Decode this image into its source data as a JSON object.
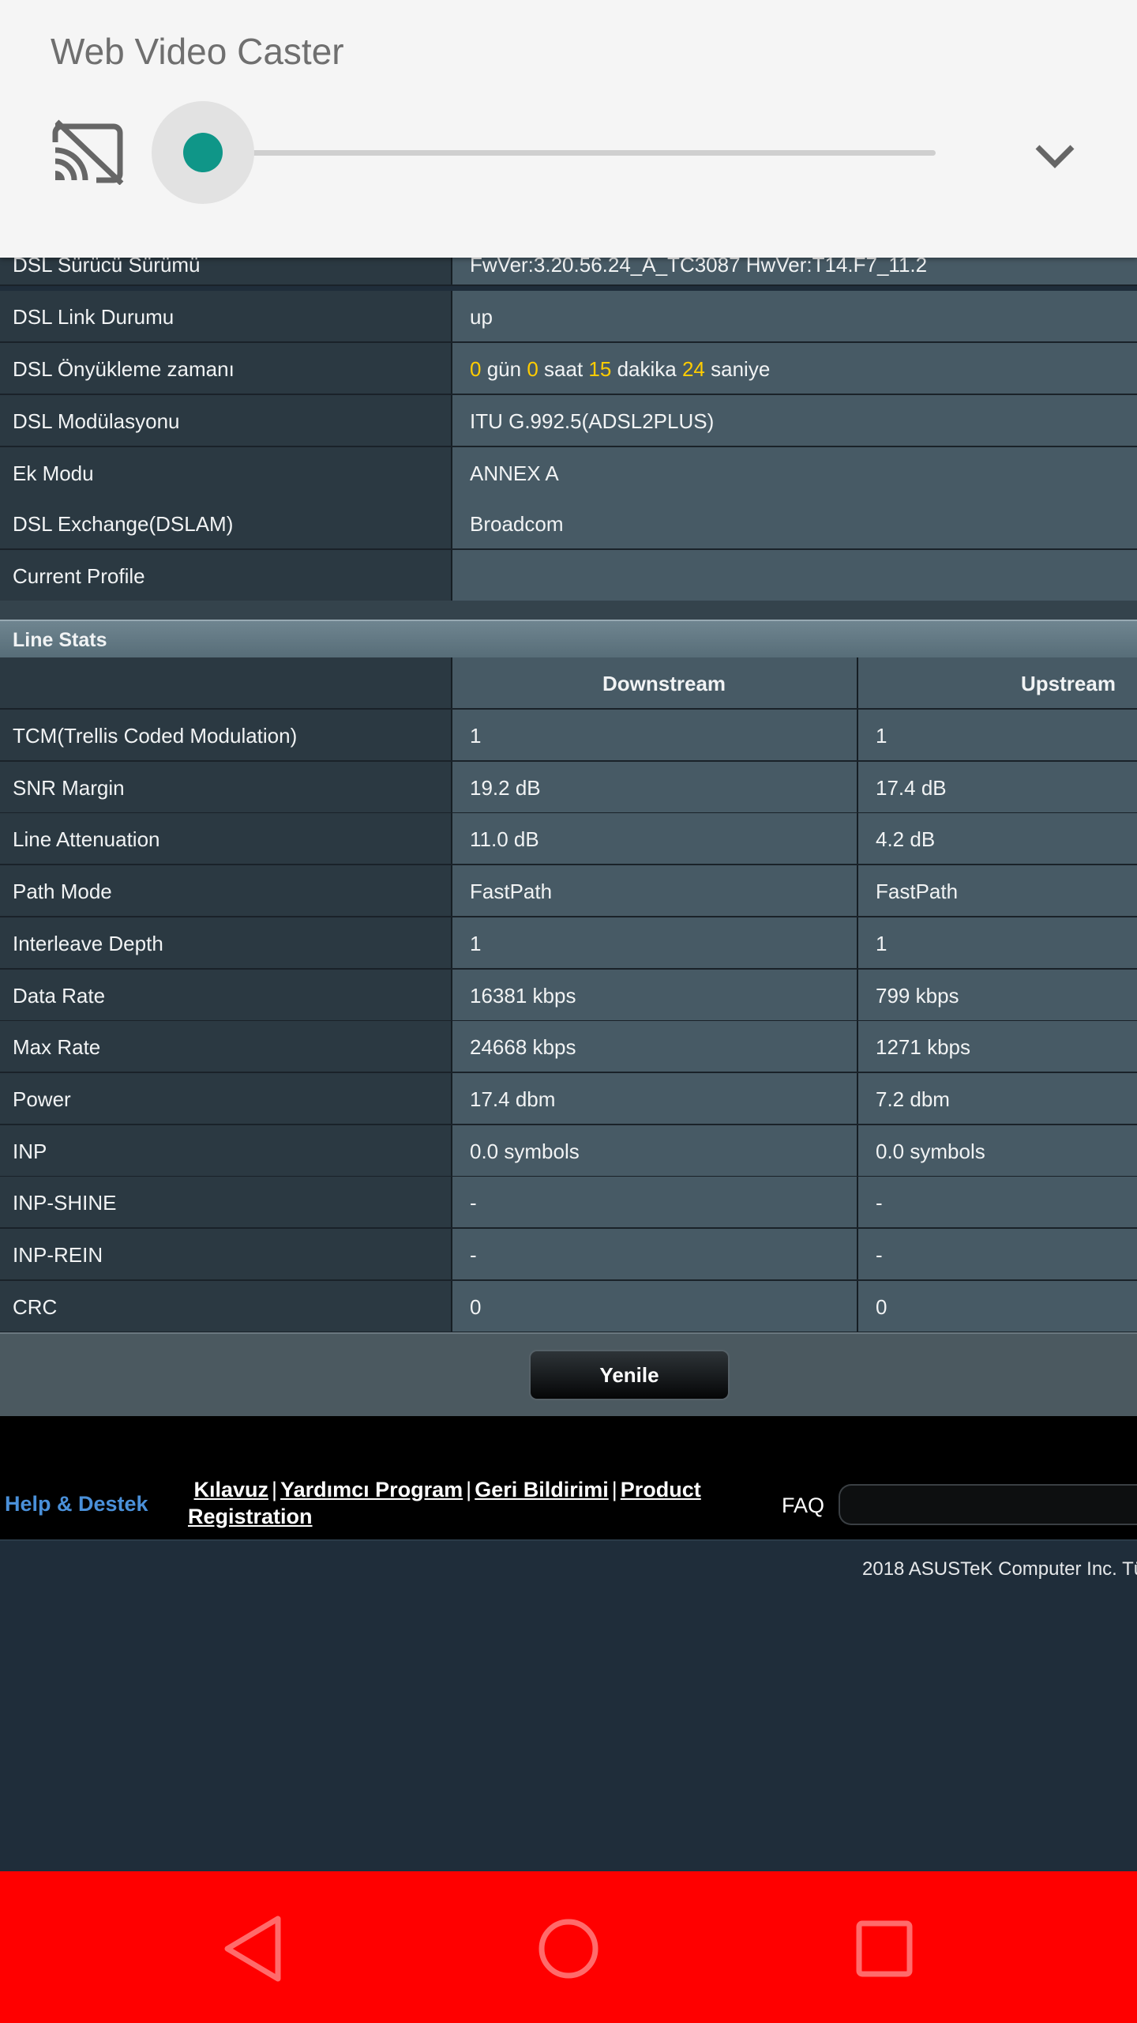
{
  "notification": {
    "app_title": "Web Video Caster",
    "cast_icon": "cast-off-icon",
    "slider_value_fraction": 0.0,
    "expand_icon": "chevron-down-icon",
    "accent_color": "#0f9688"
  },
  "info_rows": [
    {
      "label": "DSL Sürücü Sürümü",
      "value": "FwVer:3.20.56.24_A_TC3087 HwVer:T14.F7_11.2"
    },
    {
      "label": "DSL Link Durumu",
      "value": "up"
    },
    {
      "label": "DSL Önyükleme zamanı",
      "uptime": {
        "days": "0",
        "days_label": "gün",
        "hours": "0",
        "hours_label": "saat",
        "minutes": "15",
        "minutes_label": "dakika",
        "seconds": "24",
        "seconds_label": "saniye"
      }
    },
    {
      "label": "DSL Modülasyonu",
      "value": "ITU G.992.5(ADSL2PLUS)"
    },
    {
      "label": "Ek Modu",
      "value": "ANNEX A"
    },
    {
      "label": "DSL Exchange(DSLAM)",
      "value": "Broadcom"
    },
    {
      "label": "Current Profile",
      "value": ""
    }
  ],
  "line_stats": {
    "title": "Line Stats",
    "headers": {
      "downstream": "Downstream",
      "upstream": "Upstream"
    },
    "rows": [
      {
        "label": "TCM(Trellis Coded Modulation)",
        "down": "1",
        "up": "1"
      },
      {
        "label": "SNR Margin",
        "down": "19.2 dB",
        "up": "17.4 dB"
      },
      {
        "label": "Line Attenuation",
        "down": "11.0 dB",
        "up": "4.2 dB"
      },
      {
        "label": "Path Mode",
        "down": "FastPath",
        "up": "FastPath"
      },
      {
        "label": "Interleave Depth",
        "down": "1",
        "up": "1"
      },
      {
        "label": "Data Rate",
        "down": "16381 kbps",
        "up": "799 kbps"
      },
      {
        "label": "Max Rate",
        "down": "24668 kbps",
        "up": "1271 kbps"
      },
      {
        "label": "Power",
        "down": "17.4 dbm",
        "up": "7.2 dbm"
      },
      {
        "label": "INP",
        "down": "0.0 symbols",
        "up": "0.0 symbols"
      },
      {
        "label": "INP-SHINE",
        "down": "-",
        "up": "-"
      },
      {
        "label": "INP-REIN",
        "down": "-",
        "up": "-"
      },
      {
        "label": "CRC",
        "down": "0",
        "up": "0"
      }
    ]
  },
  "refresh_button": "Yenile",
  "footer": {
    "help_title": "Help & Destek",
    "links": [
      "Kılavuz",
      "Yardımcı Program",
      "Geri Bildirimi",
      "Product Registration"
    ],
    "separator": "|",
    "faq_label": "FAQ",
    "faq_placeholder": "",
    "copyright": "2018 ASUSTeK Computer Inc. Tü"
  },
  "nav_bar": {
    "color": "#ff0000",
    "buttons": [
      "back-icon",
      "home-icon",
      "recents-icon"
    ]
  }
}
